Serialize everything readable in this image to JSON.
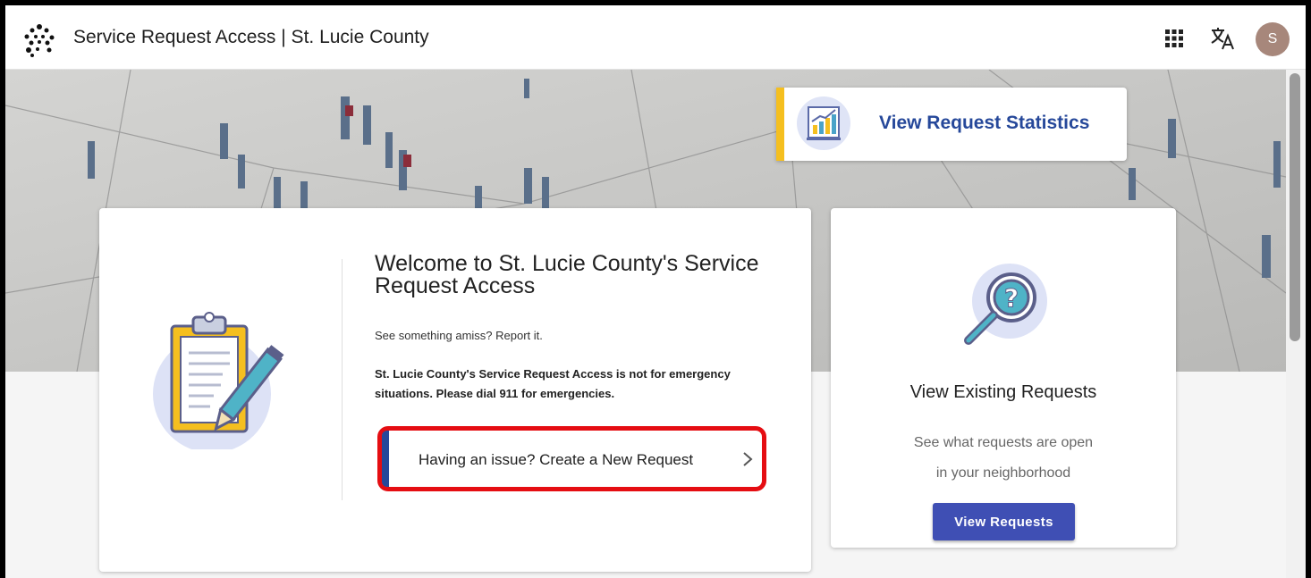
{
  "header": {
    "title": "Service Request Access | St. Lucie County",
    "avatar_initial": "S",
    "icons": {
      "logo": "dots-logo-icon",
      "apps": "apps-grid-icon",
      "translate": "translate-icon"
    }
  },
  "stats": {
    "label": "View Request Statistics",
    "icon": "bar-chart-icon"
  },
  "welcome": {
    "title": "Welcome to St. Lucie County's Service Request Access",
    "tagline": "See something amiss? Report it.",
    "notice": "St. Lucie County's Service Request Access is not for emergency situations. Please dial 911 for emergencies.",
    "new_request_label": "Having an issue? Create a New Request",
    "illustration": "clipboard-pencil-icon"
  },
  "existing": {
    "title": "View Existing Requests",
    "desc_line1": "See what requests are open",
    "desc_line2": "in your neighborhood",
    "button_label": "View Requests",
    "illustration": "magnifier-question-icon"
  },
  "colors": {
    "accent_blue": "#26489a",
    "button_blue": "#3f4fb4",
    "stats_accent": "#f5bf1f",
    "highlight_red": "#e50d12",
    "avatar": "#a7877b"
  }
}
